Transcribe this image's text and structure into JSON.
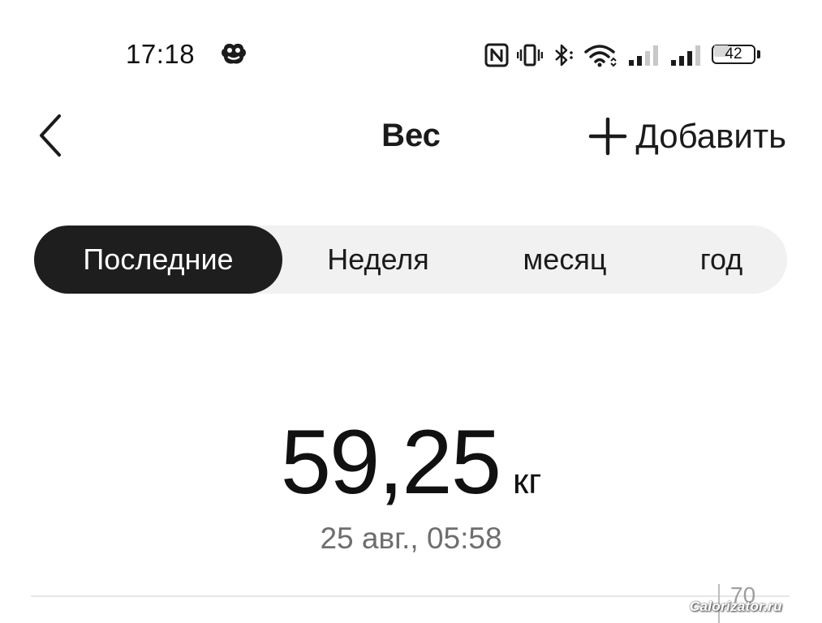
{
  "status_bar": {
    "time": "17:18",
    "battery_level": "42",
    "icons": [
      "app-badge-icon",
      "nfc-icon",
      "vibrate-icon",
      "bluetooth-icon",
      "wifi-icon",
      "signal-icon",
      "signal-icon",
      "battery-icon"
    ]
  },
  "header": {
    "title": "Вес",
    "add_label": "Добавить",
    "back_icon": "chevron-left-icon",
    "add_icon": "plus-icon"
  },
  "tabs": [
    {
      "label": "Последние",
      "active": true
    },
    {
      "label": "Неделя",
      "active": false
    },
    {
      "label": "месяц",
      "active": false
    },
    {
      "label": "год",
      "active": false
    }
  ],
  "current": {
    "value": "59,25",
    "unit": "кг",
    "timestamp": "25 авг., 05:58"
  },
  "chart": {
    "axis_tick": "70"
  },
  "watermark": "Calorizator.ru",
  "colors": {
    "active_tab_bg": "#1e1e1e",
    "tabs_bg": "#f1f1f1",
    "secondary_text": "#6e6e6e"
  }
}
